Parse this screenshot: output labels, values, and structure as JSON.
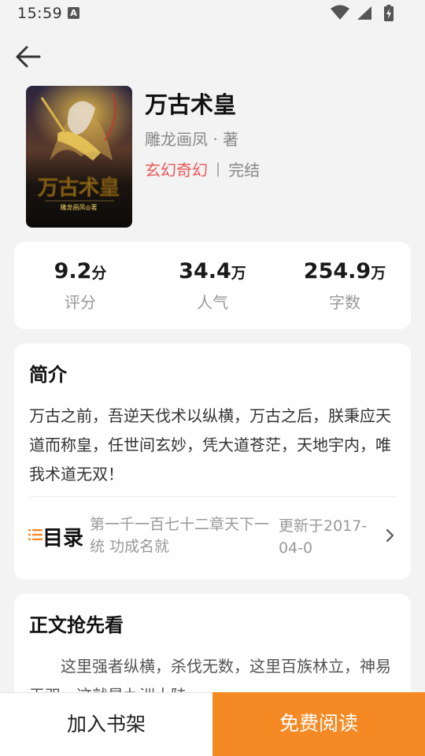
{
  "status_bar": {
    "time": "15:59",
    "notification_icon": "A"
  },
  "header": {
    "back_icon": "arrow-left-icon"
  },
  "book": {
    "title": "万古术皇",
    "author": "雕龙画凤 · 著",
    "genre": "玄幻奇幻",
    "separator": "|",
    "status": "完结",
    "cover_title": "万古术皇",
    "cover_author": "雕龙画凤◎著"
  },
  "stats": [
    {
      "value": "9.2",
      "unit": "分",
      "label": "评分"
    },
    {
      "value": "34.4",
      "unit": "万",
      "label": "人气"
    },
    {
      "value": "254.9",
      "unit": "万",
      "label": "字数"
    }
  ],
  "intro": {
    "title": "简介",
    "text": "万古之前，吾逆天伐术以纵横，万古之后，朕秉应天道而称皇，任世间玄妙，凭大道苍茫，天地宇内，唯我术道无双！"
  },
  "toc": {
    "label": "目录",
    "latest_chapter": "第一千一百七十二章天下一统 功成名就",
    "updated": "更新于2017-04-0"
  },
  "preview": {
    "title": "正文抢先看",
    "text": "这里强者纵横，杀伐无数，这里百族林立，神易无双，这就是九洲大陆。"
  },
  "actions": {
    "add_to_shelf": "加入书架",
    "read_free": "免费阅读"
  },
  "colors": {
    "accent": "#f58a25",
    "genre": "#e8585a",
    "background": "#f3f3f3"
  }
}
